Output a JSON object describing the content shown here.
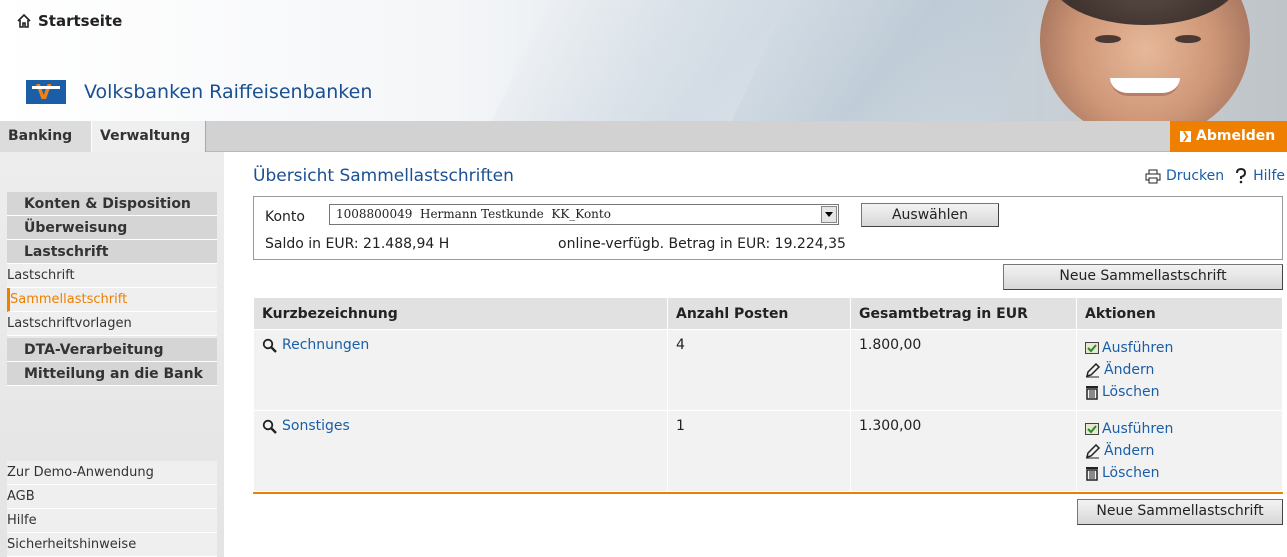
{
  "header": {
    "home_label": "Startseite",
    "brand_name": "Volksbanken Raiffeisenbanken",
    "brand_logo_text": "V"
  },
  "nav": {
    "tabs": [
      "Banking",
      "Verwaltung"
    ],
    "logout_label": "Abmelden",
    "accent_color": "#ee7f00"
  },
  "sidebar": {
    "items": [
      {
        "label": "Konten & Disposition",
        "type": "main"
      },
      {
        "label": "Überweisung",
        "type": "main"
      },
      {
        "label": "Lastschrift",
        "type": "main"
      },
      {
        "label": "Lastschrift",
        "type": "sub"
      },
      {
        "label": "Sammellastschrift",
        "type": "sub",
        "active": true
      },
      {
        "label": "Lastschriftvorlagen",
        "type": "sub"
      },
      {
        "label": "DTA-Verarbeitung",
        "type": "main"
      },
      {
        "label": "Mitteilung an die Bank",
        "type": "main"
      }
    ],
    "footer": [
      "Zur Demo-Anwendung",
      "AGB",
      "Hilfe",
      "Sicherheitshinweise"
    ]
  },
  "main": {
    "title": "Übersicht Sammellastschriften",
    "print_label": "Drucken",
    "help_label": "Hilfe",
    "konto_label": "Konto",
    "konto_value": "1008800049  Hermann Testkunde  KK_Konto",
    "select_button": "Auswählen",
    "saldo": "Saldo in EUR:  21.488,94 H",
    "verfuegbar": "online-verfügb. Betrag in EUR:  19.224,35",
    "new_button": "Neue Sammellastschrift",
    "table": {
      "headers": [
        "Kurzbezeichnung",
        "Anzahl Posten",
        "Gesamtbetrag in EUR",
        "Aktionen"
      ],
      "rows": [
        {
          "name": "Rechnungen",
          "count": "4",
          "total": "1.800,00"
        },
        {
          "name": "Sonstiges",
          "count": "1",
          "total": "1.300,00"
        }
      ],
      "actions": [
        "Ausführen",
        "Ändern",
        "Löschen"
      ]
    }
  }
}
